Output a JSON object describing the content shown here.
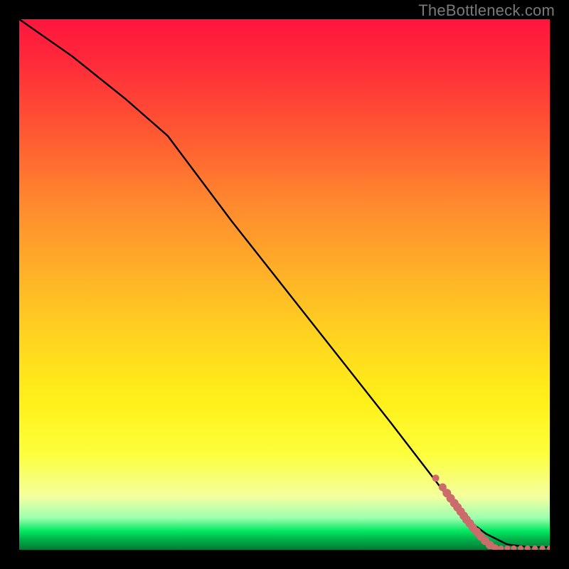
{
  "watermark": "TheBottleneck.com",
  "chart_data": {
    "type": "line",
    "title": "",
    "xlabel": "",
    "ylabel": "",
    "xlim": [
      0,
      100
    ],
    "ylim": [
      0,
      100
    ],
    "series": [
      {
        "name": "curve",
        "kind": "line",
        "x": [
          0,
          10,
          20,
          28,
          40,
          55,
          70,
          80,
          84,
          88,
          92,
          96,
          100
        ],
        "y": [
          100,
          93,
          85,
          78,
          62,
          43,
          24,
          11,
          6,
          3,
          1,
          0.5,
          0.5
        ]
      },
      {
        "name": "markers",
        "kind": "scatter",
        "points": [
          {
            "x": 78.5,
            "y": 13.5,
            "r": 5
          },
          {
            "x": 79.8,
            "y": 11.8,
            "r": 5.5
          },
          {
            "x": 80.6,
            "y": 10.7,
            "r": 6
          },
          {
            "x": 81.3,
            "y": 9.7,
            "r": 6
          },
          {
            "x": 82.0,
            "y": 8.8,
            "r": 6
          },
          {
            "x": 82.6,
            "y": 8.0,
            "r": 6
          },
          {
            "x": 83.2,
            "y": 7.2,
            "r": 6
          },
          {
            "x": 83.8,
            "y": 6.4,
            "r": 6
          },
          {
            "x": 84.3,
            "y": 5.7,
            "r": 6
          },
          {
            "x": 84.9,
            "y": 5.0,
            "r": 6
          },
          {
            "x": 85.5,
            "y": 4.2,
            "r": 6
          },
          {
            "x": 86.2,
            "y": 3.4,
            "r": 6
          },
          {
            "x": 87.0,
            "y": 2.5,
            "r": 6
          },
          {
            "x": 87.8,
            "y": 1.7,
            "r": 6
          },
          {
            "x": 88.7,
            "y": 0.9,
            "r": 6
          },
          {
            "x": 89.7,
            "y": 0.4,
            "r": 5
          },
          {
            "x": 90.8,
            "y": 0.3,
            "r": 4
          },
          {
            "x": 92.0,
            "y": 0.3,
            "r": 4
          },
          {
            "x": 93.2,
            "y": 0.3,
            "r": 4
          },
          {
            "x": 94.5,
            "y": 0.3,
            "r": 4
          },
          {
            "x": 95.8,
            "y": 0.3,
            "r": 4
          },
          {
            "x": 97.2,
            "y": 0.3,
            "r": 4
          },
          {
            "x": 98.6,
            "y": 0.3,
            "r": 4
          },
          {
            "x": 100.0,
            "y": 0.3,
            "r": 4
          }
        ]
      }
    ],
    "gradient_bands": [
      {
        "stop": 0,
        "color": "#ff153e"
      },
      {
        "stop": 0.48,
        "color": "#ffb128"
      },
      {
        "stop": 0.72,
        "color": "#fff019"
      },
      {
        "stop": 0.94,
        "color": "#9cffb0"
      },
      {
        "stop": 1.0,
        "color": "#007a33"
      }
    ]
  }
}
